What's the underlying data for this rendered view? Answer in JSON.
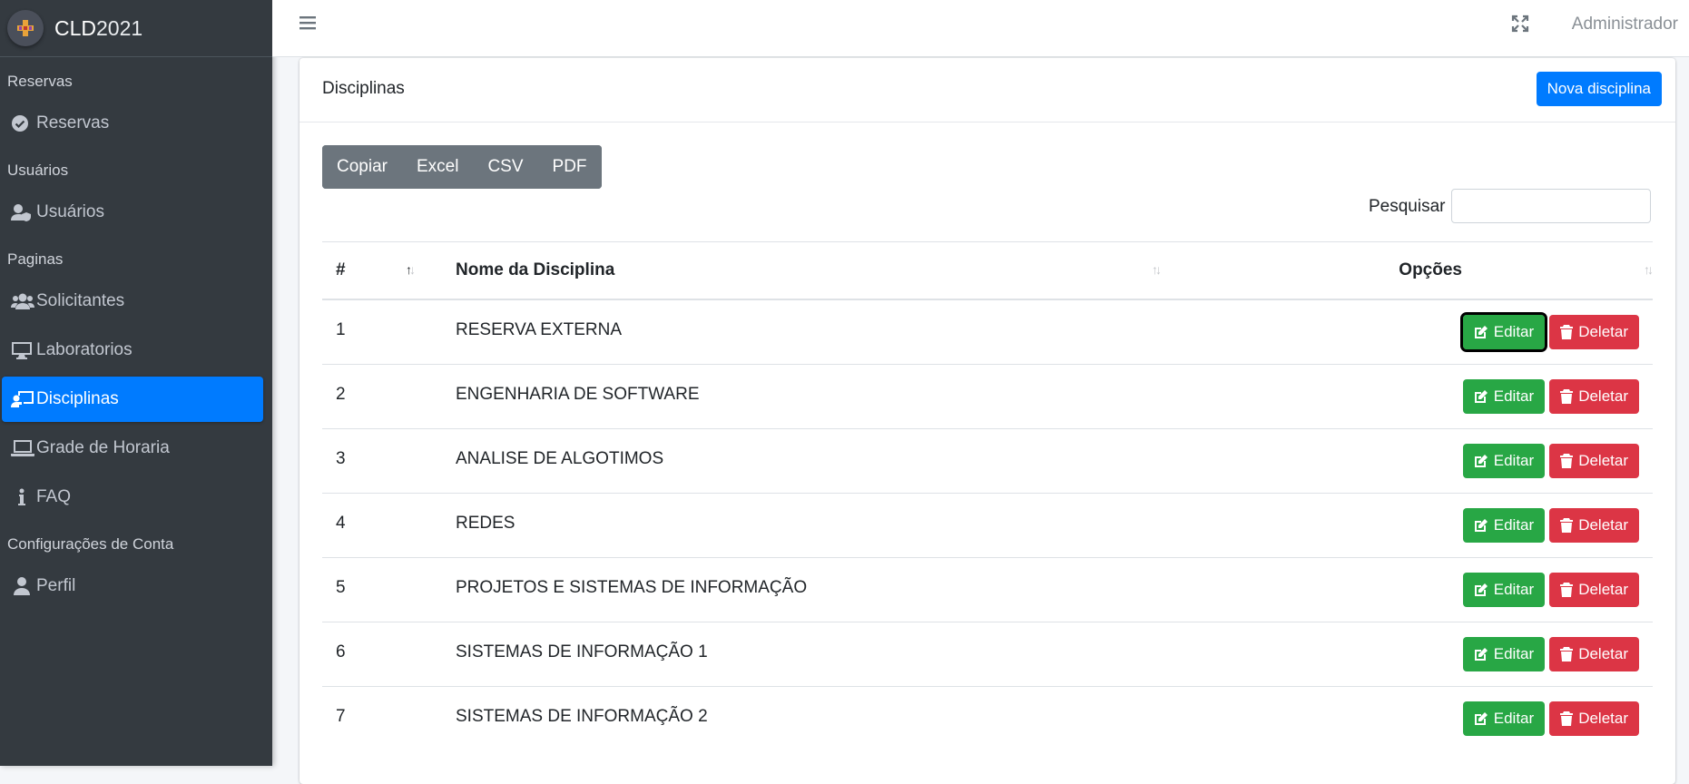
{
  "brand": {
    "name_bold": "CLD",
    "name_light": "2021"
  },
  "sidebar": {
    "sections": [
      {
        "header": "Reservas",
        "items": [
          {
            "label": "Reservas",
            "icon": "check-circle-icon"
          }
        ]
      },
      {
        "header": "Usuários",
        "items": [
          {
            "label": "Usuários",
            "icon": "user-shield-icon"
          }
        ]
      },
      {
        "header": "Paginas",
        "items": [
          {
            "label": "Solicitantes",
            "icon": "users-icon"
          },
          {
            "label": "Laboratorios",
            "icon": "desktop-icon"
          },
          {
            "label": "Disciplinas",
            "icon": "chalkboard-teacher-icon",
            "active": true
          },
          {
            "label": "Grade de Horaria",
            "icon": "laptop-icon"
          },
          {
            "label": "FAQ",
            "icon": "info-icon"
          }
        ]
      },
      {
        "header": "Configurações de Conta",
        "items": [
          {
            "label": "Perfil",
            "icon": "user-icon"
          }
        ]
      }
    ]
  },
  "topbar": {
    "user": "Administrador"
  },
  "card": {
    "title": "Disciplinas",
    "new_button": "Nova disciplina",
    "export_buttons": [
      "Copiar",
      "Excel",
      "CSV",
      "PDF"
    ],
    "search_label": "Pesquisar",
    "search_value": ""
  },
  "table": {
    "headers": [
      "#",
      "Nome da Disciplina",
      "Opções"
    ],
    "edit_label": "Editar",
    "delete_label": "Deletar",
    "rows": [
      {
        "id": "1",
        "name": "RESERVA EXTERNA"
      },
      {
        "id": "2",
        "name": "ENGENHARIA DE SOFTWARE"
      },
      {
        "id": "3",
        "name": "ANALISE DE ALGOTIMOS"
      },
      {
        "id": "4",
        "name": "REDES"
      },
      {
        "id": "5",
        "name": "PROJETOS E SISTEMAS DE INFORMAÇÃO"
      },
      {
        "id": "6",
        "name": "SISTEMAS DE INFORMAÇÃO 1"
      },
      {
        "id": "7",
        "name": "SISTEMAS DE INFORMAÇÃO 2"
      }
    ]
  },
  "colors": {
    "sidebar": "#343a40",
    "active": "#007bff",
    "edit": "#28a745",
    "delete": "#dc3545",
    "export": "#6c757d"
  }
}
